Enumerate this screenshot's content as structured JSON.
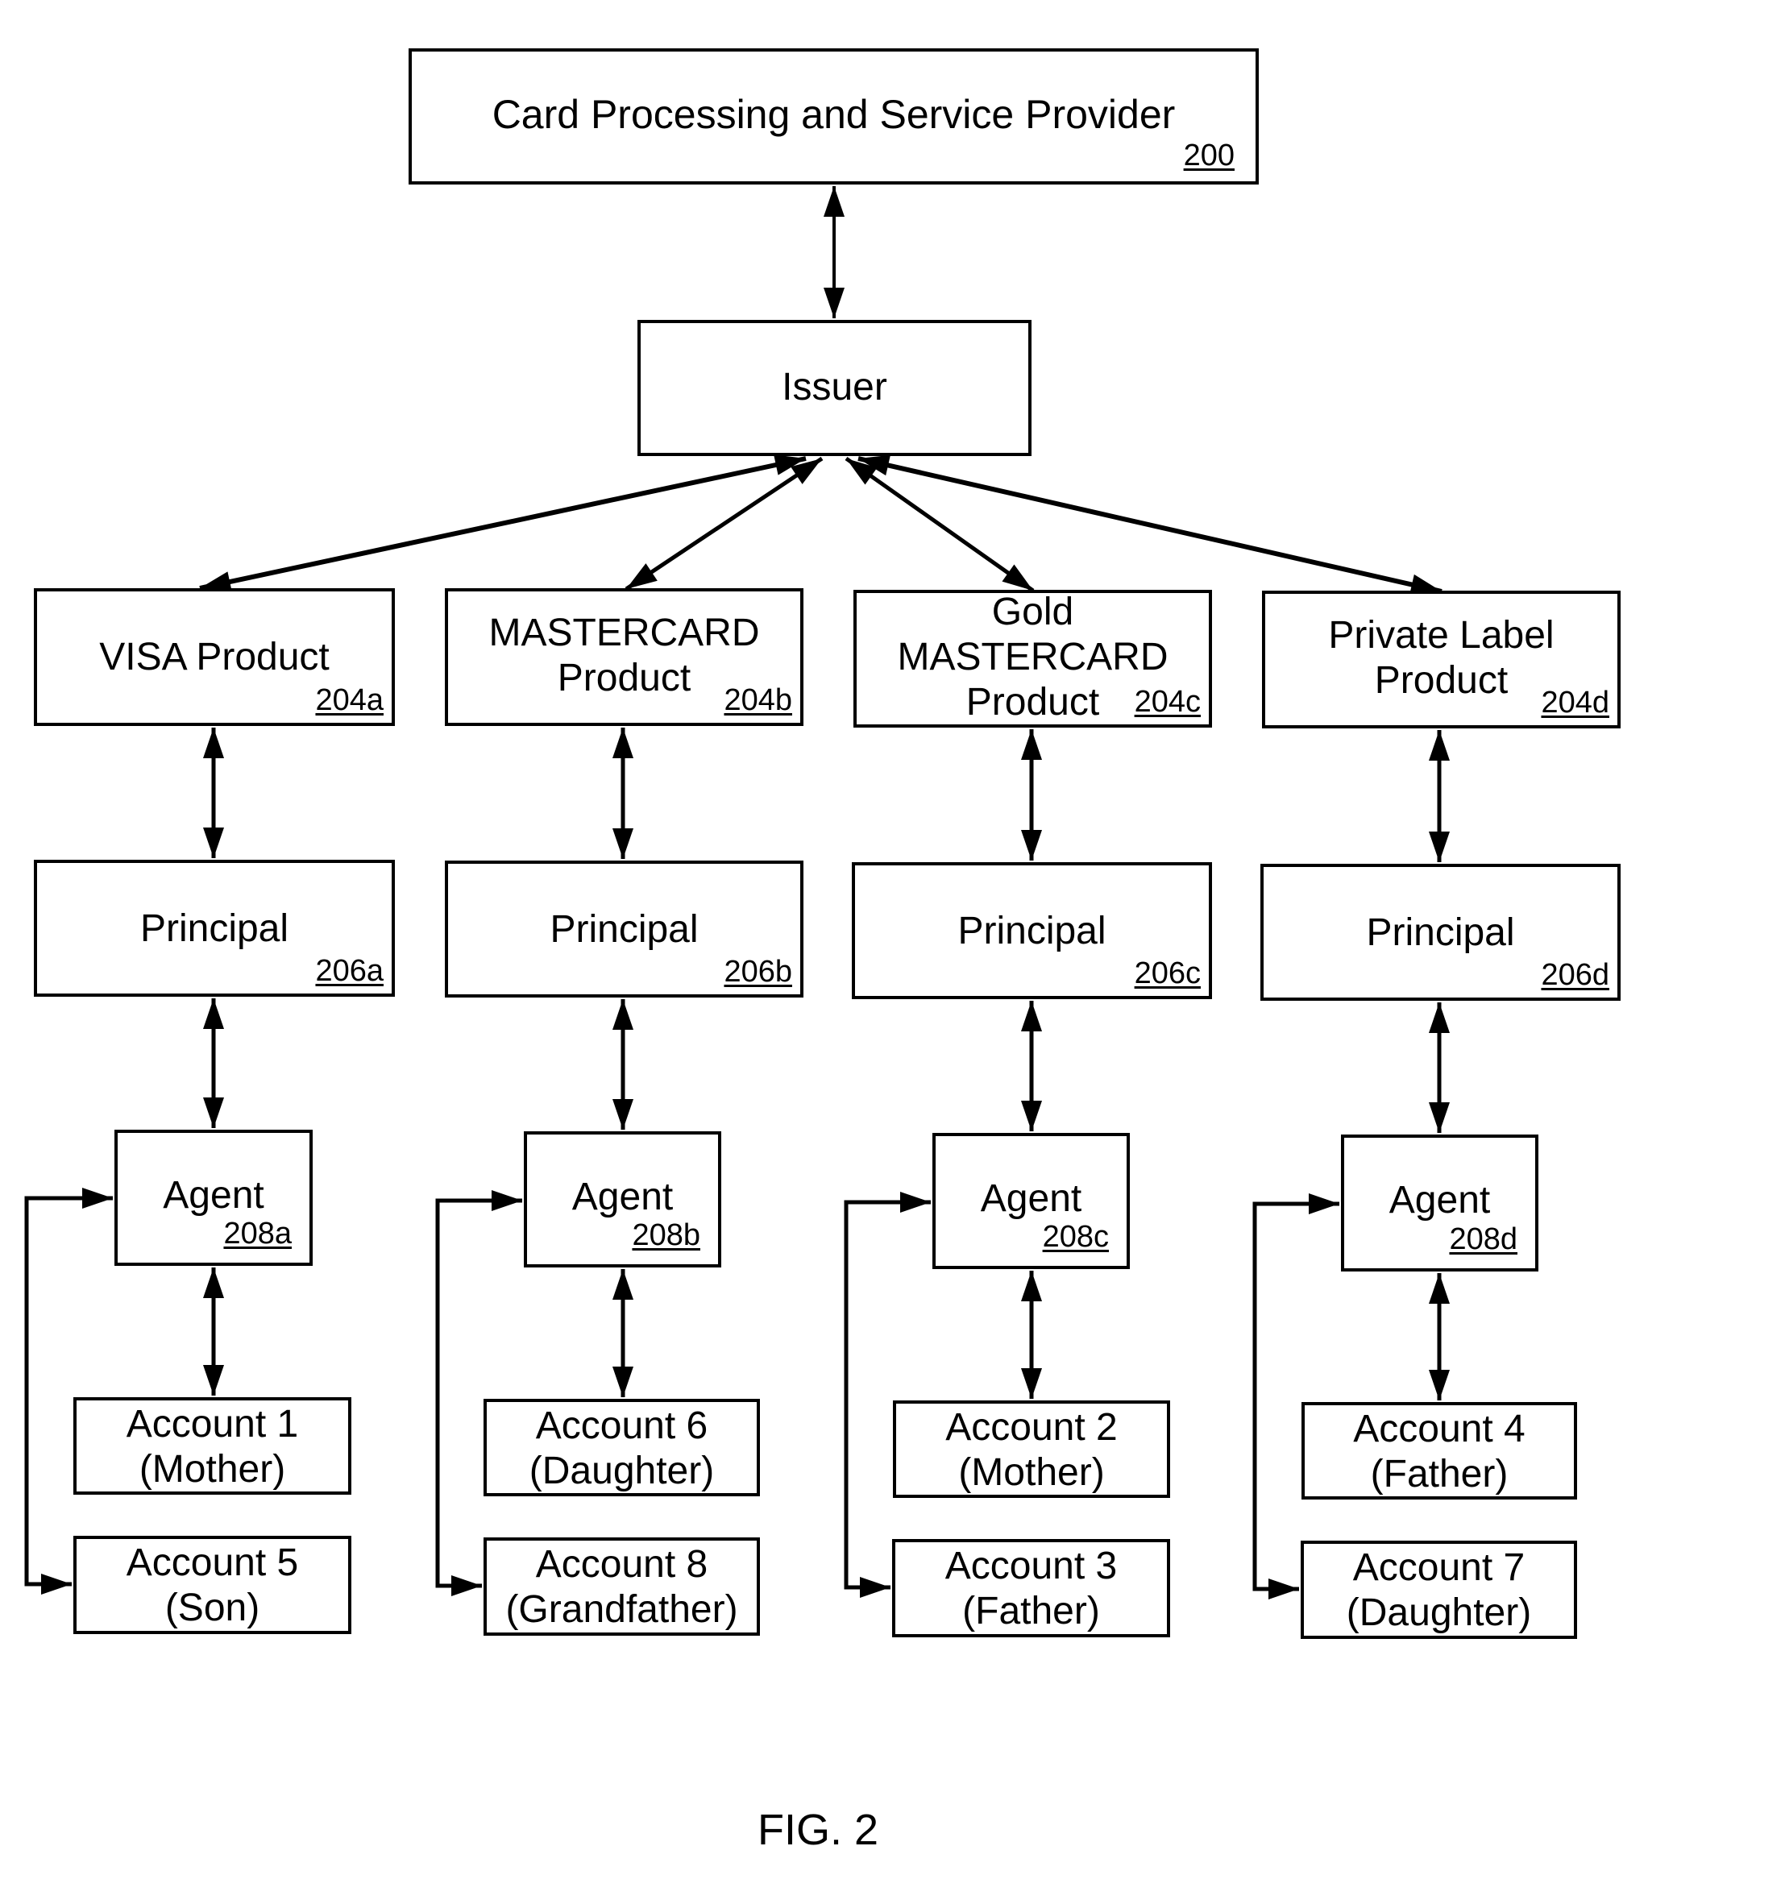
{
  "figure": {
    "caption": "FIG. 2"
  },
  "provider": {
    "label": "Card Processing and Service Provider",
    "ref": "200"
  },
  "issuer": {
    "label": "Issuer"
  },
  "columns": [
    {
      "product": {
        "label": "VISA Product",
        "ref": "204a"
      },
      "principal": {
        "label": "Principal",
        "ref": "206a"
      },
      "agent": {
        "label": "Agent",
        "ref": "208a"
      },
      "accounts": [
        {
          "label": "Account 1",
          "holder": "(Mother)"
        },
        {
          "label": "Account 5",
          "holder": "(Son)"
        }
      ]
    },
    {
      "product": {
        "label": "MASTERCARD\nProduct",
        "ref": "204b"
      },
      "principal": {
        "label": "Principal",
        "ref": "206b"
      },
      "agent": {
        "label": "Agent",
        "ref": "208b"
      },
      "accounts": [
        {
          "label": "Account 6",
          "holder": "(Daughter)"
        },
        {
          "label": "Account 8",
          "holder": "(Grandfather)"
        }
      ]
    },
    {
      "product": {
        "label": "Gold\nMASTERCARD\nProduct",
        "ref": "204c"
      },
      "principal": {
        "label": "Principal",
        "ref": "206c"
      },
      "agent": {
        "label": "Agent",
        "ref": "208c"
      },
      "accounts": [
        {
          "label": "Account 2",
          "holder": "(Mother)"
        },
        {
          "label": "Account 3",
          "holder": "(Father)"
        }
      ]
    },
    {
      "product": {
        "label": "Private Label\nProduct",
        "ref": "204d"
      },
      "principal": {
        "label": "Principal",
        "ref": "206d"
      },
      "agent": {
        "label": "Agent",
        "ref": "208d"
      },
      "accounts": [
        {
          "label": "Account 4",
          "holder": "(Father)"
        },
        {
          "label": "Account 7",
          "holder": "(Daughter)"
        }
      ]
    }
  ]
}
